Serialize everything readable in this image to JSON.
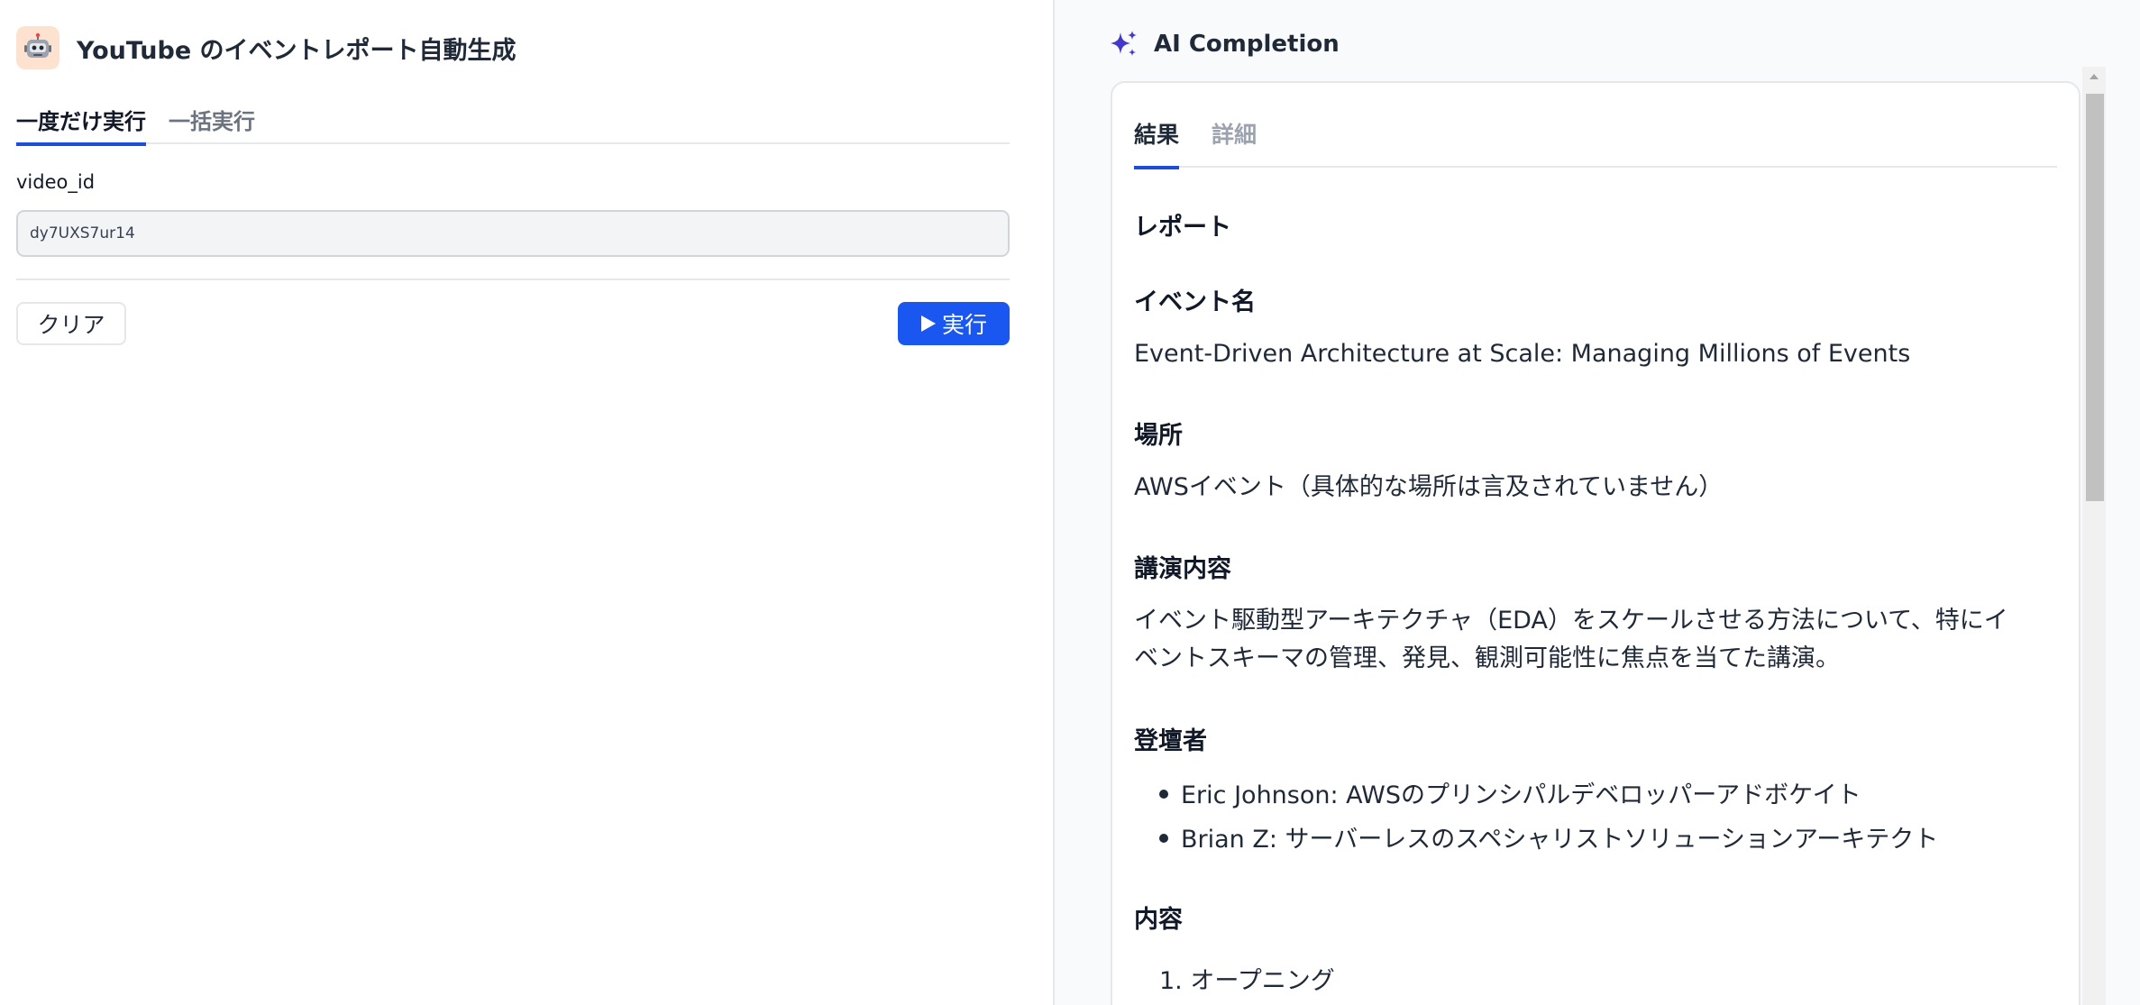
{
  "app": {
    "title": "YouTube のイベントレポート自動生成",
    "icon": "robot-icon"
  },
  "tabs_left": [
    {
      "label": "一度だけ実行",
      "active": true
    },
    {
      "label": "一括実行",
      "active": false
    }
  ],
  "form": {
    "label": "video_id",
    "value": "dy7UXS7ur14"
  },
  "buttons": {
    "clear": "クリア",
    "run": "実行",
    "run_icon": "play-icon"
  },
  "ai": {
    "title": "AI Completion",
    "icon": "sparkles-icon",
    "tabs": [
      {
        "label": "結果",
        "active": true
      },
      {
        "label": "詳細",
        "active": false
      }
    ]
  },
  "report": {
    "heading": "レポート",
    "event_heading": "イベント名",
    "event_name": "Event-Driven Architecture at Scale: Managing Millions of Events",
    "place_heading": "場所",
    "place": "AWSイベント（具体的な場所は言及されていません）",
    "content_heading": "講演内容",
    "content_line1": "イベント駆動型アーキテクチャ（EDA）をスケールさせる方法について、特にイ",
    "content_line2": "ベントスキーマの管理、発見、観測可能性に焦点を当てた講演。",
    "speakers_heading": "登壇者",
    "speakers": [
      "Eric Johnson: AWSのプリンシパルデベロッパーアドボケイト",
      "Brian Z: サーバーレスのスペシャリストソリューションアーキテクト"
    ],
    "agenda_heading": "内容",
    "agenda": [
      "1. オープニング"
    ]
  },
  "colors": {
    "accent": "#1a56f0",
    "sparkle": "#4338ca"
  }
}
